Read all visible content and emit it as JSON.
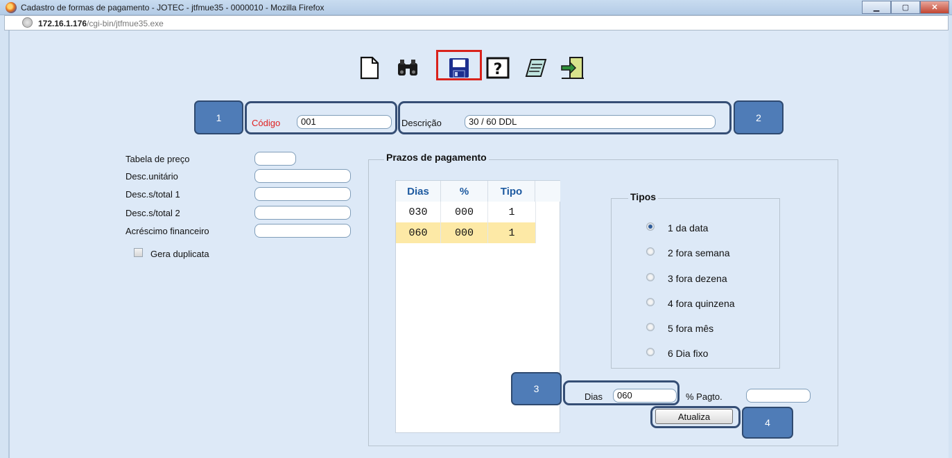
{
  "window": {
    "title": "Cadastro de formas de pagamento - JOTEC - jtfmue35 - 0000010 - Mozilla Firefox",
    "url_host": "172.16.1.176",
    "url_path": "/cgi-bin/jtfmue35.exe",
    "minimize_symbol": "▁",
    "maximize_symbol": "▢",
    "close_symbol": "✕"
  },
  "toolbar": {
    "icons": [
      "new-document-icon",
      "binoculars-search-icon",
      "floppy-save-icon",
      "help-icon",
      "notepad-icon",
      "exit-door-icon"
    ],
    "highlight_color": "#d9221b"
  },
  "callouts": {
    "c1": "1",
    "c2": "2",
    "c3": "3",
    "c4": "4"
  },
  "header": {
    "codigo_label": "Código",
    "codigo_value": "001",
    "codigo_label_color": "#e02020",
    "descricao_label": "Descrição",
    "descricao_value": "30 / 60 DDL"
  },
  "left_form": {
    "tabela_preco_label": "Tabela de preço",
    "tabela_preco_value": "",
    "desc_unitario_label": "Desc.unitário",
    "desc_unitario_value": "",
    "desc_total1_label": "Desc.s/total 1",
    "desc_total1_value": "",
    "desc_total2_label": "Desc.s/total 2",
    "desc_total2_value": "",
    "acrescimo_label": "Acréscimo financeiro",
    "acrescimo_value": "",
    "gera_duplicata_label": "Gera duplicata",
    "gera_duplicata_checked": false
  },
  "prazos": {
    "legend": "Prazos de pagamento",
    "columns": [
      "Dias",
      "%",
      "Tipo"
    ],
    "rows": [
      {
        "dias": "030",
        "pct": "000",
        "tipo": "1",
        "selected": false
      },
      {
        "dias": "060",
        "pct": "000",
        "tipo": "1",
        "selected": true
      }
    ],
    "selected_row_color": "#fde9a6"
  },
  "tipos": {
    "legend": "Tipos",
    "options": [
      "1 da data",
      "2 fora semana",
      "3 fora dezena",
      "4 fora quinzena",
      "5 fora mês",
      "6 Dia fixo"
    ],
    "selected": "1 da data"
  },
  "edit": {
    "dias_label": "Dias",
    "dias_value": "060",
    "pagto_label": "% Pagto.",
    "pagto_value": "",
    "atualiza_label": "Atualiza"
  },
  "colors": {
    "callout": "#4f7cb7",
    "page_bg": "#dde9f7"
  }
}
